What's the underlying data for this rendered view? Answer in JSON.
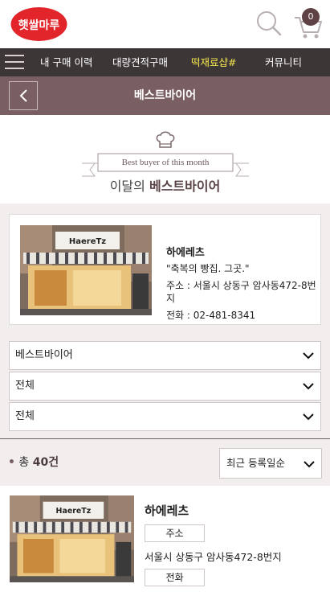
{
  "header": {
    "logo_text": "햇쌀마루",
    "cart_count": "0"
  },
  "nav": {
    "items": [
      {
        "label": "내 구매 이력"
      },
      {
        "label": "대량견적구매"
      },
      {
        "label": "떡재료샵#"
      },
      {
        "label": "커뮤니티"
      }
    ]
  },
  "titlebar": {
    "title": "베스트바이어"
  },
  "banner": {
    "ribbon_text": "Best buyer of this month",
    "title_prefix": "이달의",
    "title_emphasis": "베스트바이어"
  },
  "featured": {
    "sign_text": "HaereTz",
    "name": "하에레츠",
    "slogan": "\"축복의 빵집. 그곳.\"",
    "address": "주소 : 서울시 상동구 암사동472-8번지",
    "phone": "전화 : 02-481-8341"
  },
  "filters": [
    {
      "value": "베스트바이어"
    },
    {
      "value": "전체"
    },
    {
      "value": "전체"
    }
  ],
  "count": {
    "bullet": "•",
    "prefix": "총",
    "number": "40건"
  },
  "sort": {
    "value": "최근 등록일순"
  },
  "list": [
    {
      "name": "하에레츠",
      "address_label": "주소",
      "address": "서울시 상동구 암사동472-8번지",
      "phone_label": "전화"
    }
  ],
  "colors": {
    "brand_red": "#e2242b",
    "nav_bg": "#3d3637",
    "title_bg": "#7a5f62",
    "highlight": "#f2e64c",
    "section_bg": "#f2eeee"
  }
}
